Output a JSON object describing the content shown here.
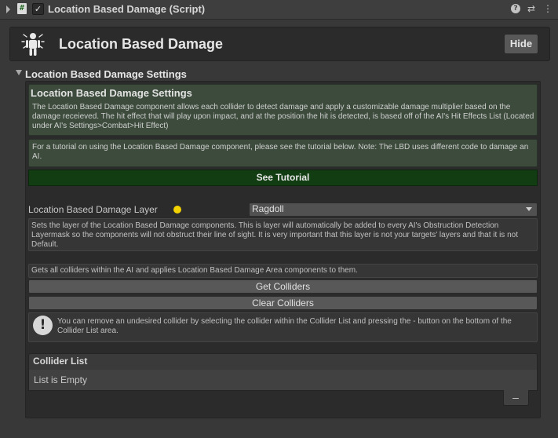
{
  "component": {
    "title": "Location Based Damage (Script)",
    "enabled": true,
    "script_icon": "#",
    "check_glyph": "✓",
    "icons": [
      "script-icon",
      "help-icon",
      "preset-icon",
      "context-menu-icon"
    ],
    "help_glyph": "?",
    "preset_glyph": "⇄",
    "menu_glyph": "⋮"
  },
  "header": {
    "title": "Location Based Damage",
    "hide_label": "Hide",
    "icon": "human-body-icon"
  },
  "settings": {
    "foldout_label": "Location Based Damage Settings",
    "info_title": "Location Based Damage Settings",
    "info_text": "The Location Based Damage component allows each collider to detect damage and apply a customizable damage multiplier based on the damage receieved. The hit effect that will play upon impact, and at the position the hit is detected, is based off of the AI's Hit Effects List (Located under AI's Settings>Combat>Hit Effect)",
    "tutorial_text": "For a tutorial on using the Location Based Damage component, please see the tutorial below. Note: The LBD uses different code to damage an AI.",
    "see_tutorial_label": "See Tutorial",
    "layer_label": "Location Based Damage Layer",
    "layer_value": "Ragdoll",
    "layer_description": "Sets the layer of the Location Based Damage components. This is layer will automatically be added to every AI's Obstruction Detection Layermask so the components will not obstruct their line of sight. It is very important that this layer is not your targets' layers and that it is not Default.",
    "colliders_description": "Gets all colliders within the AI and applies Location Based Damage Area components to them.",
    "get_colliders_label": "Get Colliders",
    "clear_colliders_label": "Clear Colliders",
    "remove_help_glyph": "!",
    "remove_help_text": "You can remove an undesired collider by selecting the collider within the Collider List and pressing the - button on the bottom of the Collider List area."
  },
  "collider_list": {
    "title": "Collider List",
    "empty_text": "List is Empty",
    "remove_label": "–"
  },
  "colors": {
    "background": "#383838",
    "info_box": "#3c4b3c",
    "tutorial_button": "#123c12",
    "layer_indicator": "#f2d200"
  }
}
